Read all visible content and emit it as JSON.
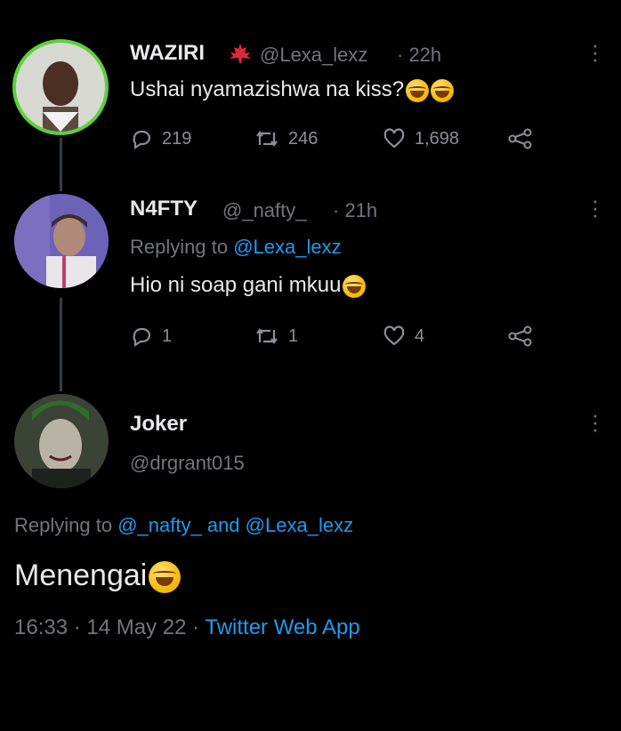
{
  "tweets": [
    {
      "name": "WAZIRI",
      "handle": "@Lexa_lexz",
      "time": "· 22h",
      "text": "Ushai nyamazishwa na kiss?",
      "replies": "219",
      "retweets": "246",
      "likes": "1,698"
    },
    {
      "name": "N4FTY",
      "handle": "@_nafty_",
      "time": "· 21h",
      "replying_prefix": "Replying to",
      "replying_handle": "@Lexa_lexz",
      "text": "Hio ni soap gani mkuu",
      "replies": "1",
      "retweets": "1",
      "likes": "4"
    }
  ],
  "focus": {
    "name": "Joker",
    "handle": "@drgrant015",
    "replying_prefix": "Replying to",
    "replying_handle1": "@_nafty_",
    "replying_and": "and",
    "replying_handle2": "@Lexa_lexz",
    "text": "Menengai",
    "timestamp": "16:33 · 14 May 22 ·",
    "source": "Twitter Web App"
  },
  "icons": {
    "flag": "maple-leaf-flag-icon",
    "reply": "reply-icon",
    "retweet": "retweet-icon",
    "like": "heart-icon",
    "share": "share-icon",
    "more": "more-vertical-icon",
    "emoji": "tears-of-joy-emoji"
  },
  "colors": {
    "background": "#000000",
    "link": "#1d9bf0",
    "muted": "#71767b",
    "avatar_ring": "#5bd13a"
  }
}
